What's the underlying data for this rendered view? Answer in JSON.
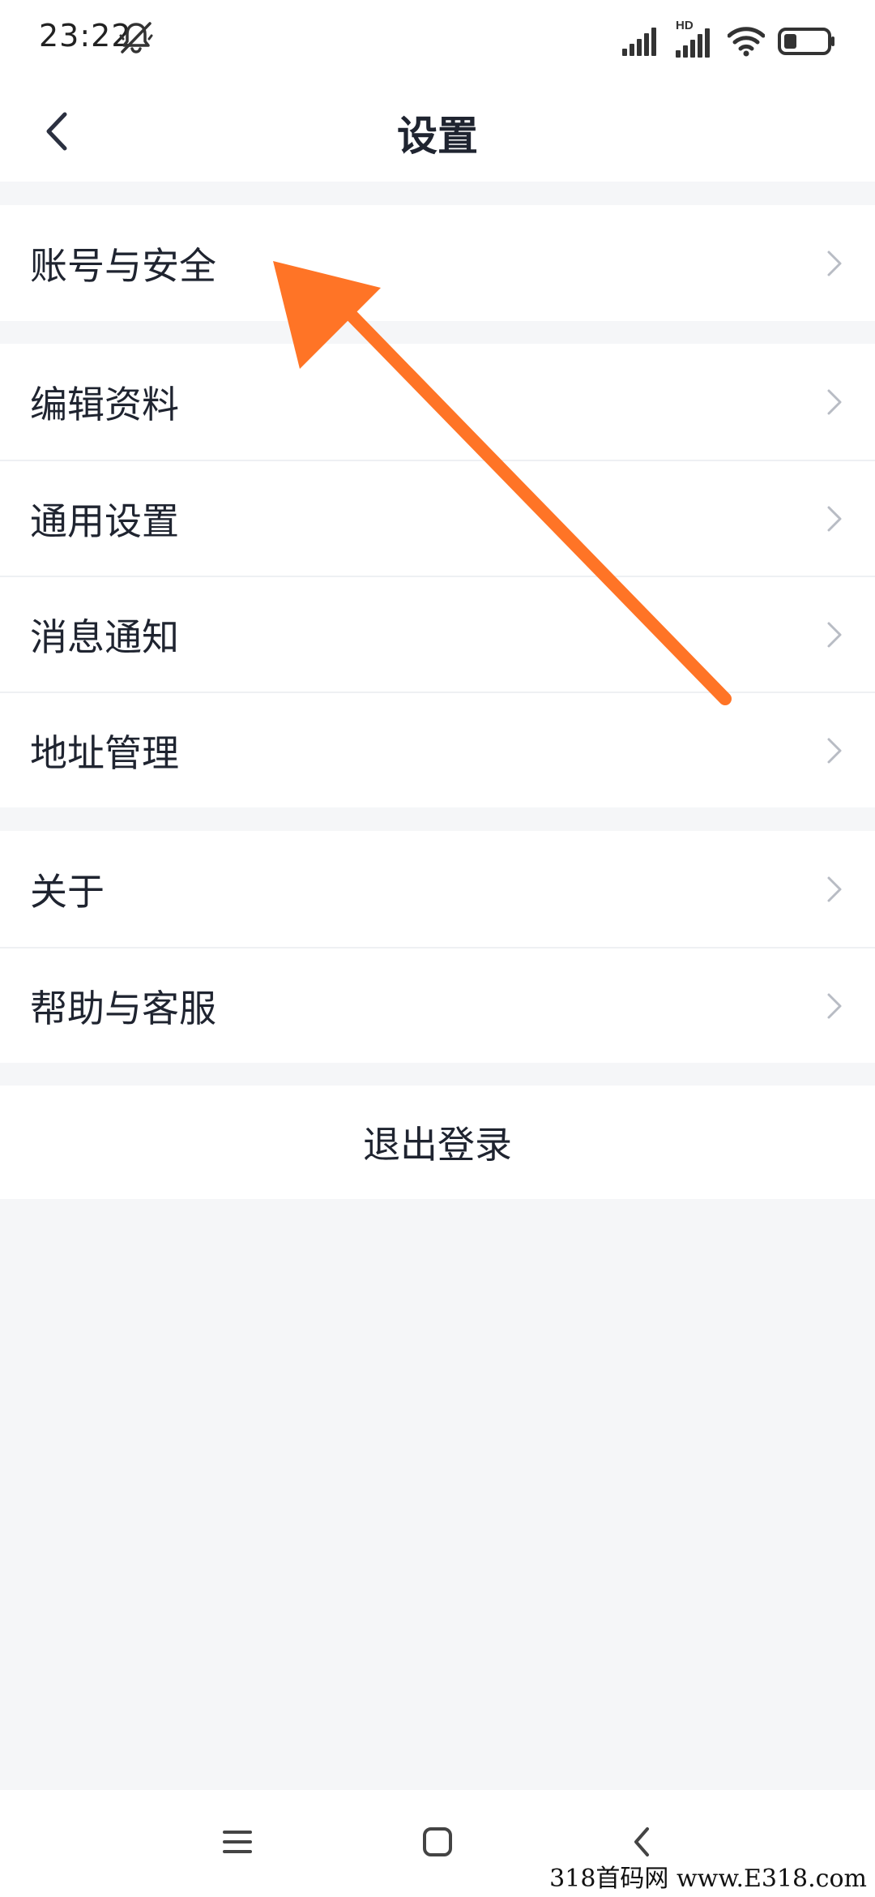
{
  "status_bar": {
    "time": "23:22",
    "network_badge": "HD",
    "battery_level": 0.3,
    "icons": [
      "mute-bell-icon",
      "cellular-signal-icon",
      "cellular-signal-hd-icon",
      "wifi-icon",
      "battery-icon"
    ]
  },
  "header": {
    "title": "设置",
    "back_icon": "chevron-left-icon"
  },
  "sections": {
    "account": [
      {
        "label": "账号与安全"
      }
    ],
    "profile": [
      {
        "label": "编辑资料"
      },
      {
        "label": "通用设置"
      },
      {
        "label": "消息通知"
      },
      {
        "label": "地址管理"
      }
    ],
    "support": [
      {
        "label": "关于"
      },
      {
        "label": "帮助与客服"
      }
    ]
  },
  "logout_label": "退出登录",
  "annotation": {
    "color": "#ff7426"
  },
  "nav_bar": {
    "icons": [
      "menu-icon",
      "home-square-icon",
      "back-chevron-icon"
    ]
  },
  "watermark": "318首码网 www.E318.com",
  "colors": {
    "background": "#f5f6f8",
    "surface": "#ffffff",
    "text": "#1f2430",
    "chevron": "#b8bcc4",
    "accent": "#ff7426"
  }
}
